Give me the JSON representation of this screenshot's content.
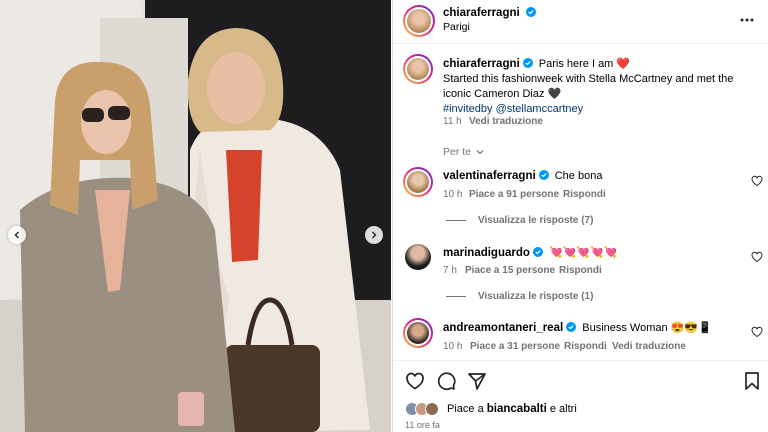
{
  "post": {
    "header": {
      "username": "chiaraferragni",
      "location": "Parigi",
      "more_icon": "more-horizontal-icon"
    },
    "caption": {
      "username": "chiaraferragni",
      "line1": "Paris here I am ❤️",
      "line2": "Started this fashionweek with Stella McCartney and met the",
      "line3": "iconic Cameron Diaz 🖤",
      "tags": "#invitedby @stellamccartney",
      "time": "11 h",
      "translate": "Vedi traduzione"
    },
    "filter": {
      "label": "Per te"
    },
    "comments": [
      {
        "username": "valentinaferragni",
        "text": "Che bona",
        "time": "10 h",
        "likes": "Piace a 91 persone",
        "reply": "Rispondi",
        "view_replies": "Visualizza le risposte (7)"
      },
      {
        "username": "marinadiguardo",
        "text": "💘💘💘💘💘",
        "time": "7 h",
        "likes": "Piace a 15 persone",
        "reply": "Rispondi",
        "view_replies": "Visualizza le risposte (1)"
      },
      {
        "username": "andreamontaneri_real",
        "text": "Business Woman 😍😎📱",
        "time": "10 h",
        "likes": "Piace a 31 persone",
        "reply": "Rispondi",
        "translate": "Vedi traduzione"
      }
    ],
    "footer": {
      "liked_prefix": "Piace a ",
      "liked_by": "biancabalti",
      "liked_suffix": " e altri",
      "time_ago": "11 ore fa"
    }
  },
  "colors": {
    "verified": "#0095f6",
    "link": "#00376b",
    "muted": "#737373"
  }
}
